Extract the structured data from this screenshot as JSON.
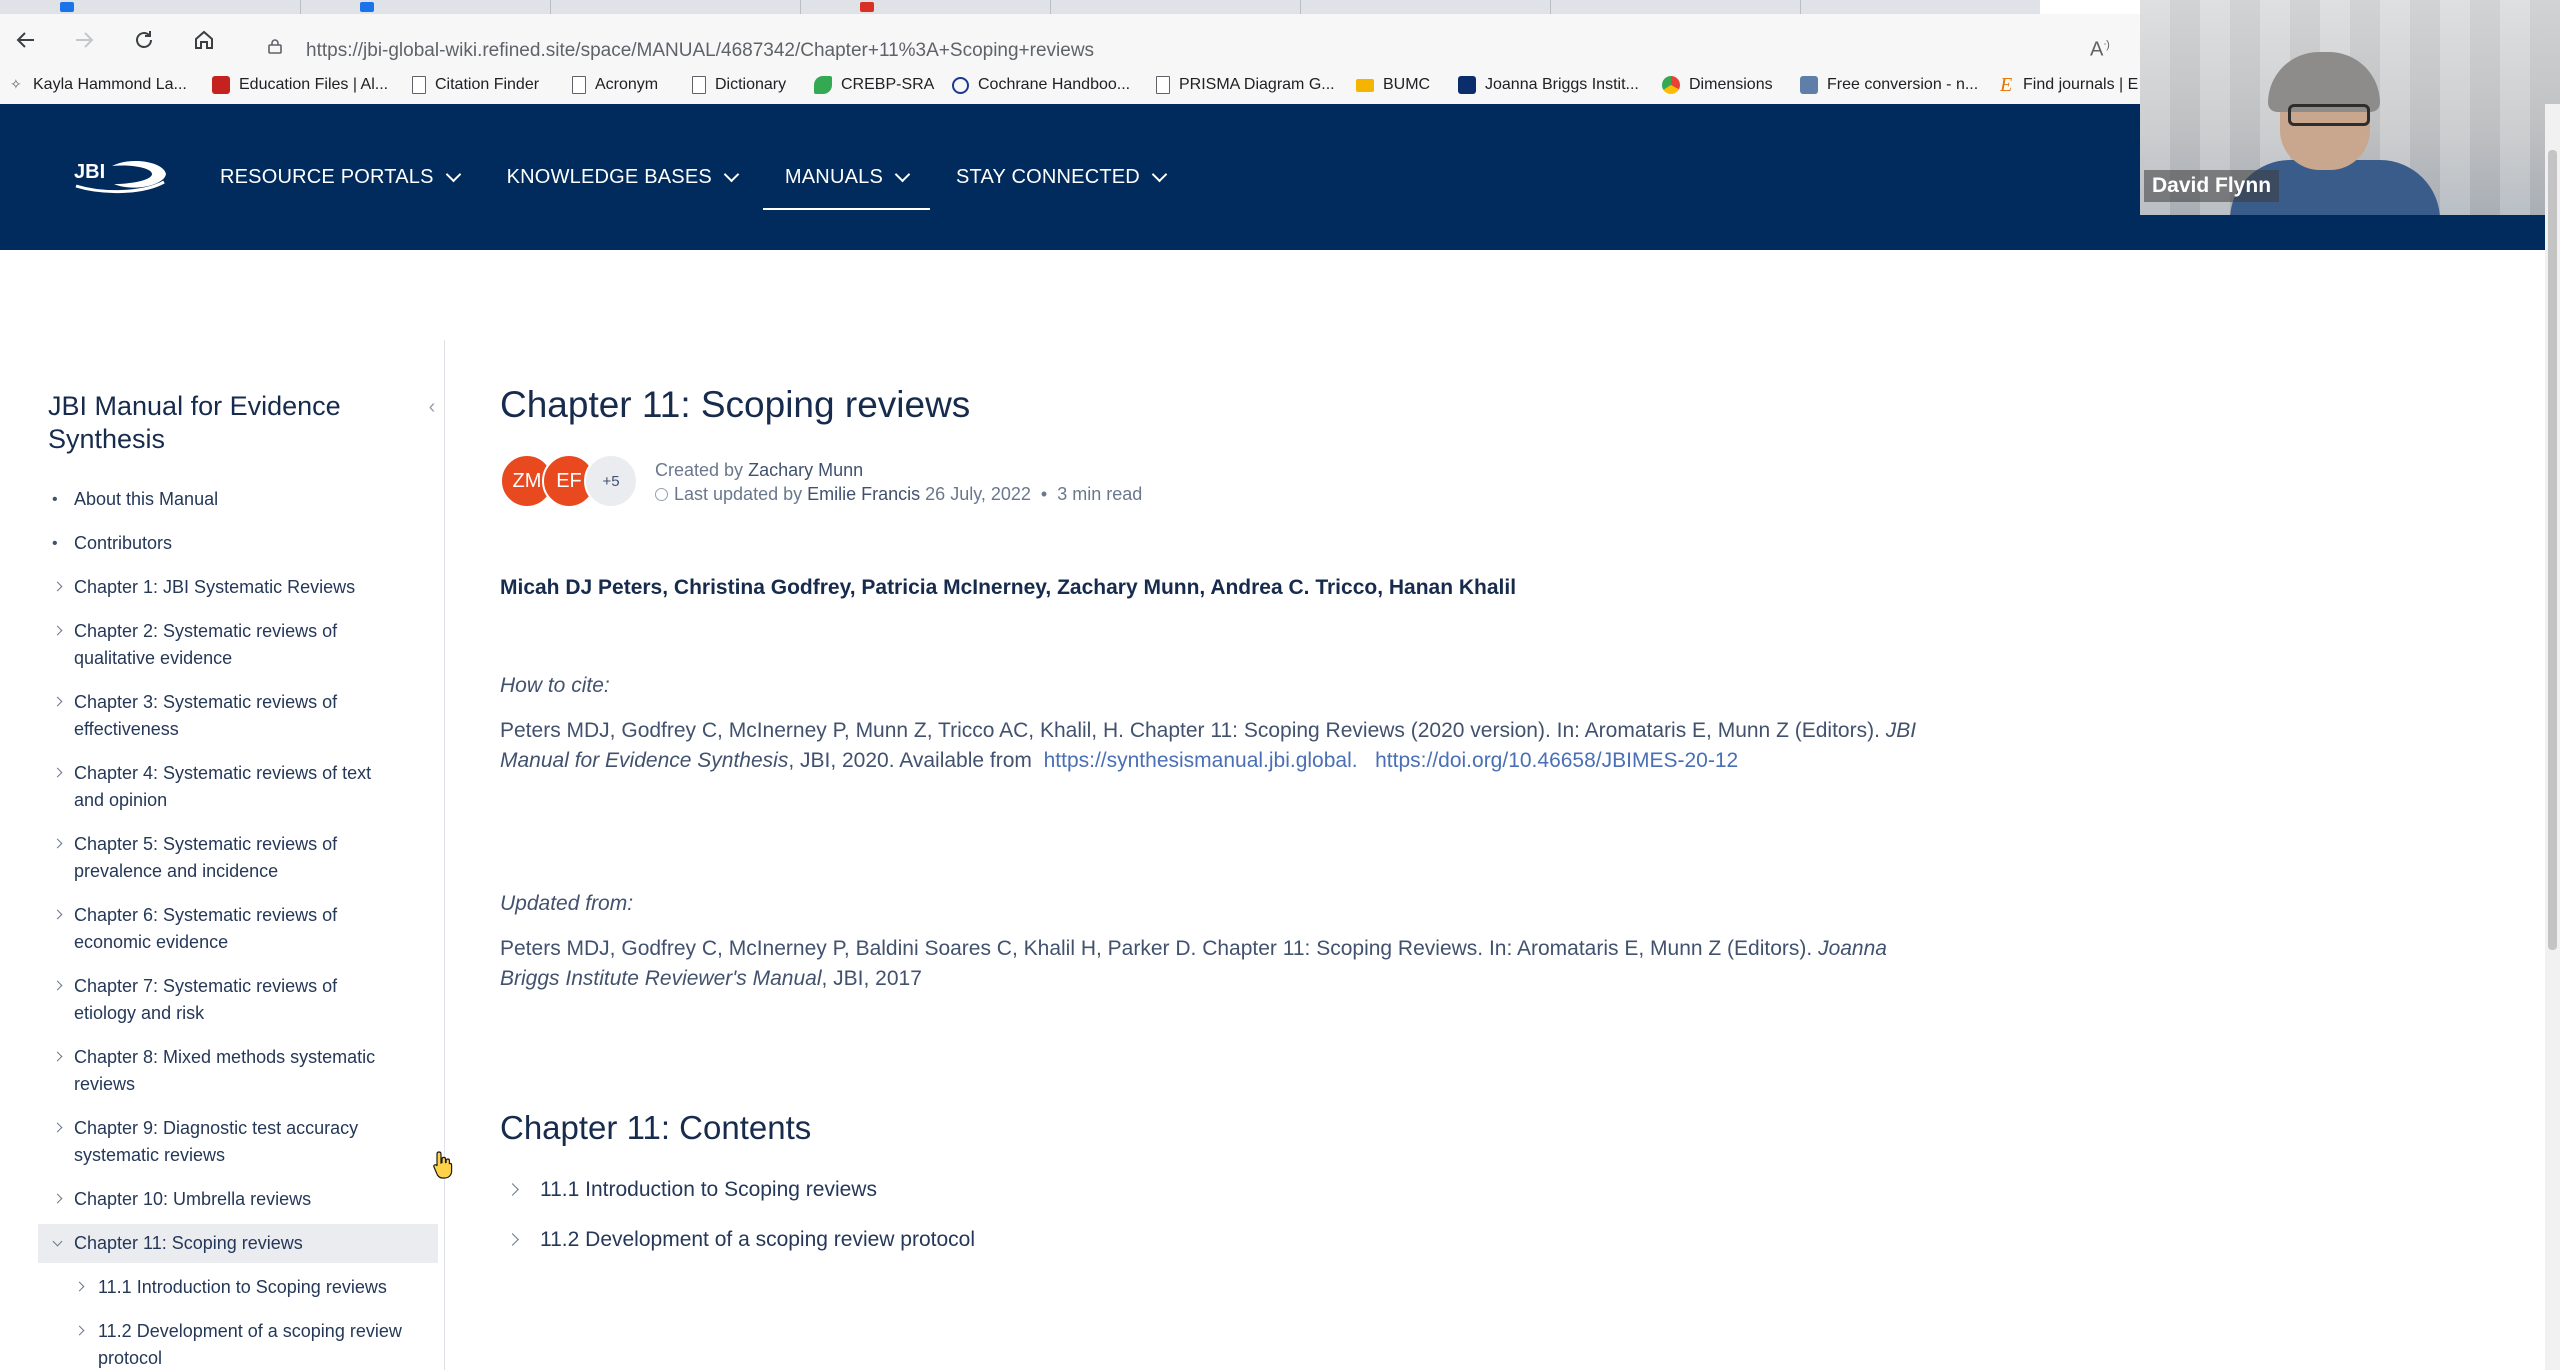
{
  "browser": {
    "url": "https://jbi-global-wiki.refined.site/space/MANUAL/4687342/Chapter+11%3A+Scoping+reviews",
    "bookmarks": [
      {
        "label": "Kayla Hammond La...",
        "icon": "bookmark-star-icon"
      },
      {
        "label": "Education Files | Al...",
        "icon": "eu-flag-icon"
      },
      {
        "label": "Citation Finder",
        "icon": "page-icon"
      },
      {
        "label": "Acronym",
        "icon": "page-icon"
      },
      {
        "label": "Dictionary",
        "icon": "page-icon"
      },
      {
        "label": "CREBP-SRA",
        "icon": "leaf-icon"
      },
      {
        "label": "Cochrane Handboo...",
        "icon": "cochrane-icon"
      },
      {
        "label": "PRISMA Diagram G...",
        "icon": "page-icon"
      },
      {
        "label": "BUMC",
        "icon": "folder-icon"
      },
      {
        "label": "Joanna Briggs Instit...",
        "icon": "jbi-icon"
      },
      {
        "label": "Dimensions",
        "icon": "dimensions-icon"
      },
      {
        "label": "Free conversion - n...",
        "icon": "convert-icon"
      },
      {
        "label": "Find journals | E",
        "icon": "elsevier-icon"
      }
    ]
  },
  "webcam": {
    "name": "David Flynn"
  },
  "header": {
    "nav": [
      {
        "label": "RESOURCE PORTALS",
        "active": false
      },
      {
        "label": "KNOWLEDGE BASES",
        "active": false
      },
      {
        "label": "MANUALS",
        "active": true
      },
      {
        "label": "STAY CONNECTED",
        "active": false
      }
    ]
  },
  "sidebar": {
    "title": "JBI Manual for Evidence Synthesis",
    "items": [
      {
        "label": "About this Manual",
        "type": "bullet"
      },
      {
        "label": "Contributors",
        "type": "bullet"
      },
      {
        "label": "Chapter 1: JBI Systematic Reviews",
        "type": "chevron"
      },
      {
        "label": "Chapter 2: Systematic reviews of qualitative evidence",
        "type": "chevron"
      },
      {
        "label": "Chapter 3: Systematic reviews of effectiveness",
        "type": "chevron"
      },
      {
        "label": "Chapter 4: Systematic reviews of text and opinion",
        "type": "chevron"
      },
      {
        "label": "Chapter 5: Systematic reviews of prevalence and incidence",
        "type": "chevron"
      },
      {
        "label": "Chapter 6: Systematic reviews of economic evidence",
        "type": "chevron"
      },
      {
        "label": "Chapter 7: Systematic reviews of etiology and risk",
        "type": "chevron"
      },
      {
        "label": "Chapter 8: Mixed methods systematic reviews",
        "type": "chevron"
      },
      {
        "label": "Chapter 9: Diagnostic test accuracy systematic reviews",
        "type": "chevron"
      },
      {
        "label": "Chapter 10: Umbrella reviews",
        "type": "chevron"
      },
      {
        "label": "Chapter 11: Scoping reviews",
        "type": "open"
      },
      {
        "label": "11.1 Introduction to Scoping reviews",
        "type": "sub"
      },
      {
        "label": "11.2 Development of a scoping review protocol",
        "type": "sub"
      }
    ]
  },
  "page": {
    "title": "Chapter 11: Scoping reviews",
    "avatars": [
      "ZM",
      "EF",
      "+5"
    ],
    "created_prefix": "Created by",
    "created_by": "Zachary Munn",
    "updated_prefix": "Last updated by",
    "updated_by": "Emilie Francis",
    "updated_date": "26 July, 2022",
    "read_time": "3 min read",
    "authors": "Micah DJ Peters, Christina Godfrey, Patricia McInerney, Zachary Munn, Andrea C. Tricco, Hanan Khalil",
    "cite_label": "How to cite:",
    "cite_text": "Peters MDJ, Godfrey C, McInerney P, Munn Z, Tricco AC, Khalil, H. Chapter 11: Scoping Reviews (2020 version). In: Aromataris E, Munn Z (Editors).",
    "cite_book": "JBI Manual for Evidence Synthesis",
    "cite_tail": ", JBI, 2020. Available from",
    "cite_link1": "https://synthesismanual.jbi.global.",
    "cite_link2": "https://doi.org/10.46658/JBIMES-20-12",
    "updated_label": "Updated from:",
    "updated_text": "Peters MDJ, Godfrey C, McInerney P, Baldini Soares C, Khalil H, Parker D. Chapter 11: Scoping Reviews. In: Aromataris E, Munn Z (Editors).",
    "updated_book": "Joanna Briggs Institute Reviewer's Manual",
    "updated_tail": ", JBI, 2017",
    "contents_title": "Chapter 11: Contents",
    "contents": [
      "11.1 Introduction to Scoping reviews",
      "11.2 Development of a scoping review protocol"
    ]
  },
  "colors": {
    "header_bg": "#002b5c",
    "avatar_bg": "#e8491f",
    "link": "#4a6fb5"
  }
}
